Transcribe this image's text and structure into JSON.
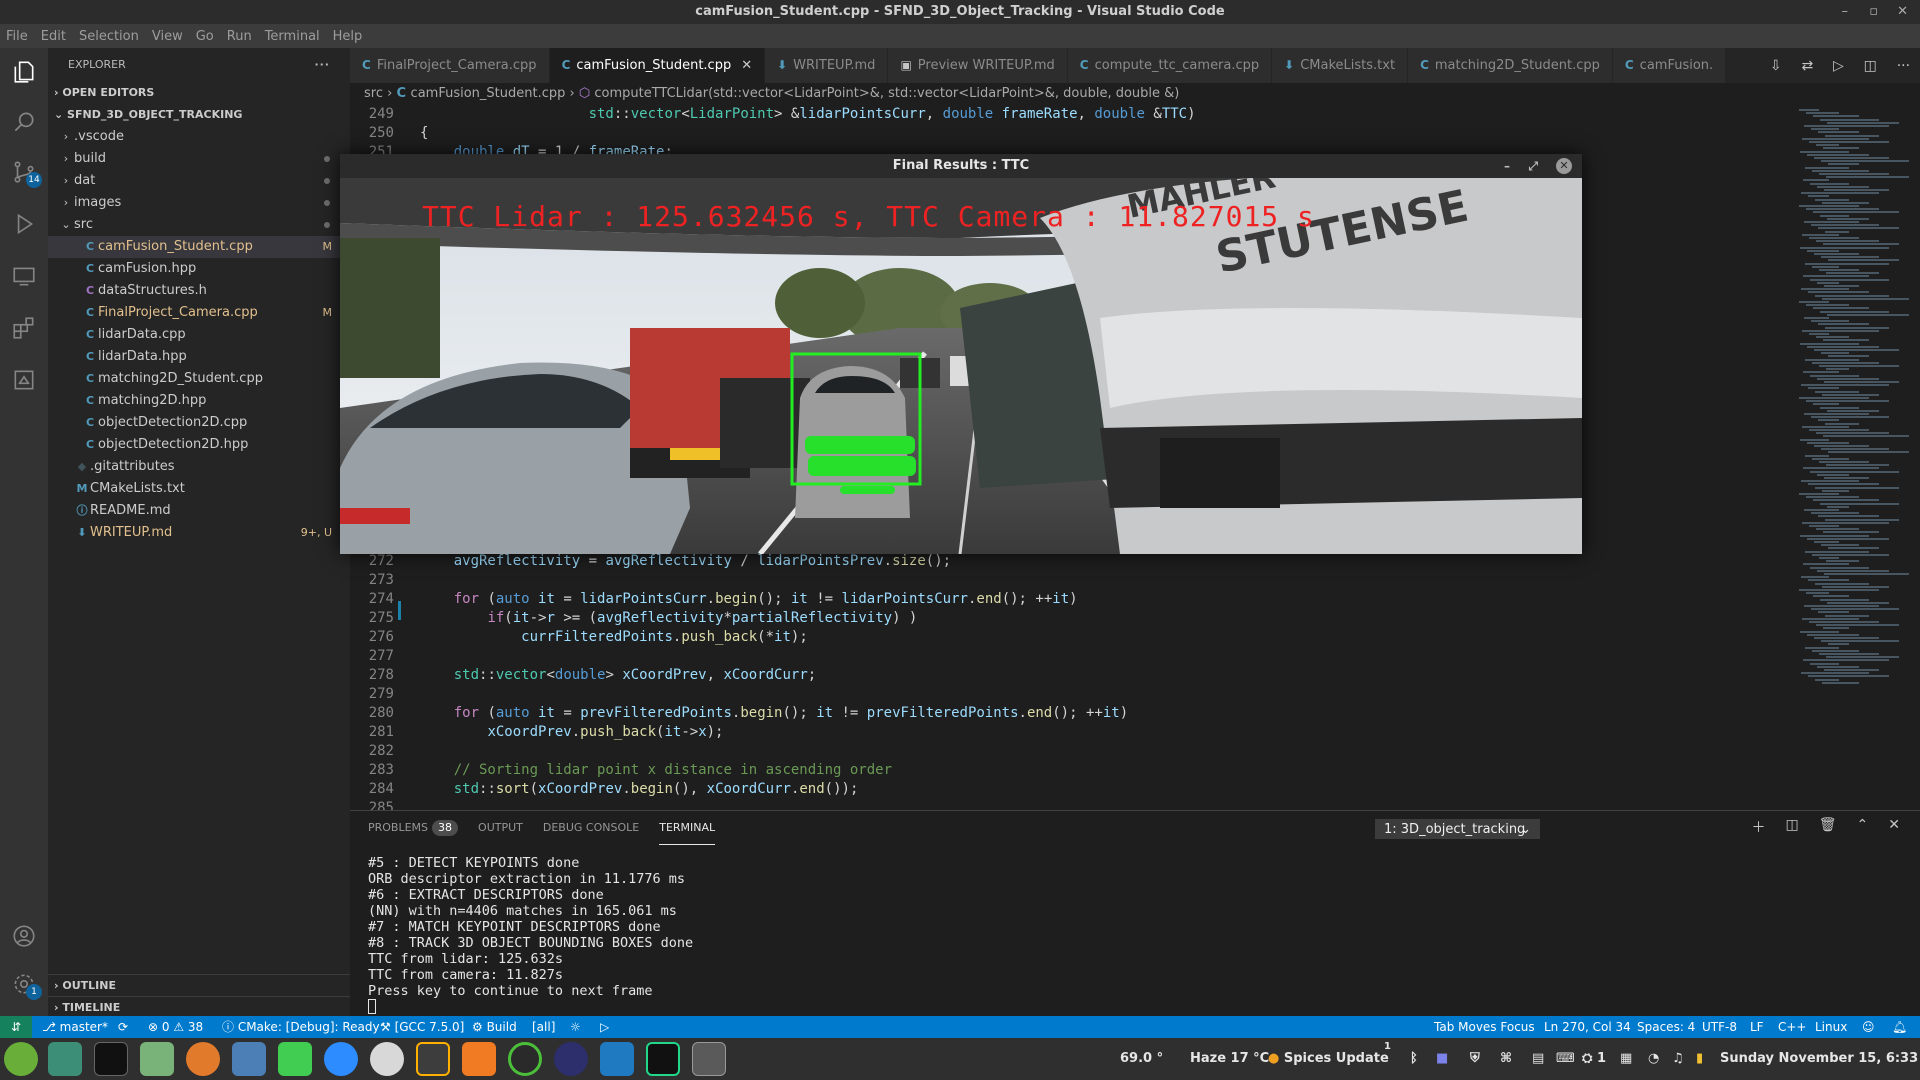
{
  "window": {
    "title": "camFusion_Student.cpp - SFND_3D_Object_Tracking - Visual Studio Code"
  },
  "menu": [
    "File",
    "Edit",
    "Selection",
    "View",
    "Go",
    "Run",
    "Terminal",
    "Help"
  ],
  "activity": {
    "scm_badge": "14",
    "settings_badge": "1"
  },
  "explorer": {
    "title": "EXPLORER",
    "open_editors": "OPEN EDITORS",
    "project": "SFND_3D_OBJECT_TRACKING",
    "items": [
      {
        "label": ".vscode",
        "kind": "folder",
        "depth": 1
      },
      {
        "label": "build",
        "kind": "folder",
        "depth": 1,
        "dot": true
      },
      {
        "label": "dat",
        "kind": "folder",
        "depth": 1,
        "dot": true
      },
      {
        "label": "images",
        "kind": "folder",
        "depth": 1,
        "dot": true
      },
      {
        "label": "src",
        "kind": "folder-open",
        "depth": 1,
        "dot": true
      },
      {
        "label": "camFusion_Student.cpp",
        "kind": "cpp",
        "depth": 2,
        "status": "M",
        "selected": true
      },
      {
        "label": "camFusion.hpp",
        "kind": "cpp",
        "depth": 2
      },
      {
        "label": "dataStructures.h",
        "kind": "c",
        "depth": 2
      },
      {
        "label": "FinalProject_Camera.cpp",
        "kind": "cpp",
        "depth": 2,
        "status": "M"
      },
      {
        "label": "lidarData.cpp",
        "kind": "cpp",
        "depth": 2
      },
      {
        "label": "lidarData.hpp",
        "kind": "cpp",
        "depth": 2
      },
      {
        "label": "matching2D_Student.cpp",
        "kind": "cpp",
        "depth": 2
      },
      {
        "label": "matching2D.hpp",
        "kind": "cpp",
        "depth": 2
      },
      {
        "label": "objectDetection2D.cpp",
        "kind": "cpp",
        "depth": 2
      },
      {
        "label": "objectDetection2D.hpp",
        "kind": "cpp",
        "depth": 2
      },
      {
        "label": ".gitattributes",
        "kind": "git",
        "depth": 1
      },
      {
        "label": "CMakeLists.txt",
        "kind": "cmake",
        "depth": 1
      },
      {
        "label": "README.md",
        "kind": "info",
        "depth": 1
      },
      {
        "label": "WRITEUP.md",
        "kind": "md",
        "depth": 1,
        "status": "9+, U"
      }
    ],
    "outline": "OUTLINE",
    "timeline": "TIMELINE"
  },
  "tabs": [
    {
      "label": "FinalProject_Camera.cpp",
      "icon": "C"
    },
    {
      "label": "camFusion_Student.cpp",
      "icon": "C",
      "active": true
    },
    {
      "label": "WRITEUP.md",
      "icon": "M"
    },
    {
      "label": "Preview WRITEUP.md",
      "icon": "P"
    },
    {
      "label": "compute_ttc_camera.cpp",
      "icon": "C"
    },
    {
      "label": "CMakeLists.txt",
      "icon": "M"
    },
    {
      "label": "matching2D_Student.cpp",
      "icon": "C"
    },
    {
      "label": "camFusion.",
      "icon": "C"
    }
  ],
  "breadcrumb": {
    "src": "src",
    "file": "camFusion_Student.cpp",
    "symbol": "computeTTCLidar(std::vector<LidarPoint>&, std::vector<LidarPoint>&, double, double &)"
  },
  "code": [
    {
      "n": "249",
      "html": "                    <span class='ty'>std</span>::<span class='ty'>vector</span>&lt;<span class='ty'>LidarPoint</span>&gt; &amp;<span class='va'>lidarPointsCurr</span>, <span class='kw'>double</span> <span class='va'>frameRate</span>, <span class='kw'>double</span> &amp;<span class='va'>TTC</span>)"
    },
    {
      "n": "250",
      "html": "{"
    },
    {
      "n": "251",
      "html": "    <span class='kw'>double</span> <span class='va'>dT</span> = 1 / <span class='va'>frameRate</span>;"
    },
    {
      "n": "272",
      "html": "    <span class='va'>avgReflectivity</span> = <span class='va'>avgReflectivity</span> / <span class='va'>lidarPointsPrev</span>.<span class='fn'>size</span>();"
    },
    {
      "n": "273",
      "html": ""
    },
    {
      "n": "274",
      "html": "    <span class='ct'>for</span> (<span class='kw'>auto</span> <span class='va'>it</span> = <span class='va'>lidarPointsCurr</span>.<span class='fn'>begin</span>(); <span class='va'>it</span> != <span class='va'>lidarPointsCurr</span>.<span class='fn'>end</span>(); ++<span class='va'>it</span>)"
    },
    {
      "n": "275",
      "html": "        <span class='ct'>if</span>(<span class='va'>it</span>-&gt;<span class='va'>r</span> &gt;= (<span class='va'>avgReflectivity</span>*<span class='va'>partialReflectivity</span>) )"
    },
    {
      "n": "276",
      "html": "            <span class='va'>currFilteredPoints</span>.<span class='fn'>push_back</span>(*<span class='va'>it</span>);"
    },
    {
      "n": "277",
      "html": ""
    },
    {
      "n": "278",
      "html": "    <span class='ty'>std</span>::<span class='ty'>vector</span>&lt;<span class='kw'>double</span>&gt; <span class='va'>xCoordPrev</span>, <span class='va'>xCoordCurr</span>;"
    },
    {
      "n": "279",
      "html": ""
    },
    {
      "n": "280",
      "html": "    <span class='ct'>for</span> (<span class='kw'>auto</span> <span class='va'>it</span> = <span class='va'>prevFilteredPoints</span>.<span class='fn'>begin</span>(); <span class='va'>it</span> != <span class='va'>prevFilteredPoints</span>.<span class='fn'>end</span>(); ++<span class='va'>it</span>)"
    },
    {
      "n": "281",
      "html": "        <span class='va'>xCoordPrev</span>.<span class='fn'>push_back</span>(<span class='va'>it</span>-&gt;<span class='va'>x</span>);"
    },
    {
      "n": "282",
      "html": ""
    },
    {
      "n": "283",
      "html": "    <span class='cm'>// Sorting lidar point x distance in ascending order</span>"
    },
    {
      "n": "284",
      "html": "    <span class='ty'>std</span>::<span class='fn'>sort</span>(<span class='va'>xCoordPrev</span>.<span class='fn'>begin</span>(), <span class='va'>xCoordCurr</span>.<span class='fn'>end</span>());"
    },
    {
      "n": "285",
      "html": ""
    }
  ],
  "popup": {
    "title": "Final Results : TTC",
    "overlay": "TTC Lidar : 125.632456 s, TTC Camera : 11.827015 s"
  },
  "panel": {
    "tabs": [
      {
        "label": "PROBLEMS",
        "badge": "38"
      },
      {
        "label": "OUTPUT"
      },
      {
        "label": "DEBUG CONSOLE"
      },
      {
        "label": "TERMINAL",
        "active": true
      }
    ],
    "terminal_select": "1: 3D_object_tracking",
    "terminal_lines": [
      "#5 : DETECT KEYPOINTS done",
      "ORB descriptor extraction in 11.1776 ms",
      "#6 : EXTRACT DESCRIPTORS done",
      "(NN) with n=4406 matches in 165.061 ms",
      "#7 : MATCH KEYPOINT DESCRIPTORS done",
      "#8 : TRACK 3D OBJECT BOUNDING BOXES done",
      "TTC from lidar: 125.632s",
      "TTC from camera: 11.827s",
      "Press key to continue to next frame"
    ]
  },
  "status": {
    "branch": "master*",
    "errors": "0",
    "warnings": "38",
    "cmake": "CMake: [Debug]: Ready",
    "kit": "[GCC 7.5.0]",
    "build": "Build",
    "target": "[all]",
    "tab_moves": "Tab Moves Focus",
    "position": "Ln 270, Col 34",
    "spaces": "Spaces: 4",
    "encoding": "UTF-8",
    "eol": "LF",
    "language": "C++",
    "os": "Linux"
  },
  "taskbar": {
    "temp_cpu": "69.0 °",
    "weather": "Haze 17 °C",
    "spices": "Spices Update",
    "spices_badge": "1",
    "bt_badge": "1",
    "clock": "Sunday November 15, 6:33 AM"
  },
  "colors": {
    "accent": "#007acc",
    "modified": "#e2c08d",
    "overlay_red": "#ee2222",
    "bbox_green": "#22ee22"
  }
}
